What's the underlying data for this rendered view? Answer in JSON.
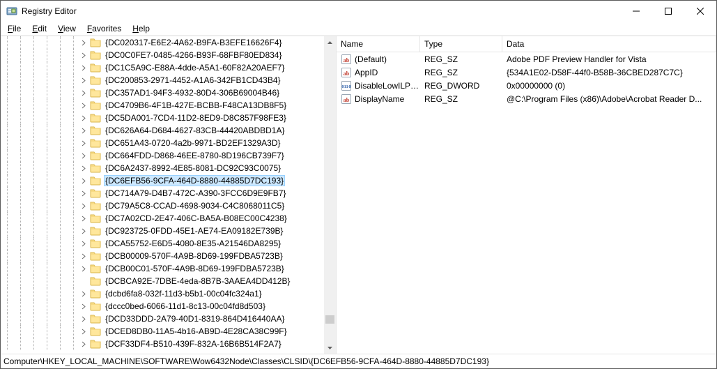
{
  "title": "Registry Editor",
  "menu": [
    "File",
    "Edit",
    "View",
    "Favorites",
    "Help"
  ],
  "tree": [
    {
      "label": "{DC020317-E6E2-4A62-B9FA-B3EFE16626F4}"
    },
    {
      "label": "{DC0C0FE7-0485-4266-B93F-68FBF80ED834}"
    },
    {
      "label": "{DC1C5A9C-E88A-4dde-A5A1-60F82A20AEF7}"
    },
    {
      "label": "{DC200853-2971-4452-A1A6-342FB1CD43B4}"
    },
    {
      "label": "{DC357AD1-94F3-4932-80D4-306B69004B46}"
    },
    {
      "label": "{DC4709B6-4F1B-427E-BCBB-F48CA13DB8F5}"
    },
    {
      "label": "{DC5DA001-7CD4-11D2-8ED9-D8C857F98FE3}"
    },
    {
      "label": "{DC626A64-D684-4627-83CB-44420ABDBD1A}"
    },
    {
      "label": "{DC651A43-0720-4a2b-9971-BD2EF1329A3D}"
    },
    {
      "label": "{DC664FDD-D868-46EE-8780-8D196CB739F7}"
    },
    {
      "label": "{DC6A2437-8992-4E85-8081-DC92C93C0075}"
    },
    {
      "label": "{DC6EFB56-9CFA-464D-8880-44885D7DC193}",
      "selected": true
    },
    {
      "label": "{DC714A79-D4B7-472C-A390-3FCC6D9E9FB7}"
    },
    {
      "label": "{DC79A5C8-CCAD-4698-9034-C4C8068011C5}"
    },
    {
      "label": "{DC7A02CD-2E47-406C-BA5A-B08EC00C4238}"
    },
    {
      "label": "{DC923725-0FDD-45E1-AE74-EA09182E739B}"
    },
    {
      "label": "{DCA55752-E6D5-4080-8E35-A21546DA8295}"
    },
    {
      "label": "{DCB00009-570F-4A9B-8D69-199FDBA5723B}"
    },
    {
      "label": "{DCB00C01-570F-4A9B-8D69-199FDBA5723B}"
    },
    {
      "label": "{DCBCA92E-7DBE-4eda-8B7B-3AAEA4DD412B}",
      "leaf": true
    },
    {
      "label": "{dcbd6fa8-032f-11d3-b5b1-00c04fc324a1}"
    },
    {
      "label": "{dccc0bed-6066-11d1-8c13-00c04fd8d503}"
    },
    {
      "label": "{DCD33DDD-2A79-40D1-8319-864D416440AA}"
    },
    {
      "label": "{DCED8DB0-11A5-4b16-AB9D-4E28CA38C99F}"
    },
    {
      "label": "{DCF33DF4-B510-439F-832A-16B6B514F2A7}"
    }
  ],
  "list": {
    "headers": {
      "name": "Name",
      "type": "Type",
      "data": "Data"
    },
    "rows": [
      {
        "icon": "sz",
        "name": "(Default)",
        "type": "REG_SZ",
        "data": "Adobe PDF Preview Handler for Vista"
      },
      {
        "icon": "sz",
        "name": "AppID",
        "type": "REG_SZ",
        "data": "{534A1E02-D58F-44f0-B58B-36CBED287C7C}"
      },
      {
        "icon": "dw",
        "name": "DisableLowILPro...",
        "type": "REG_DWORD",
        "data": "0x00000000 (0)"
      },
      {
        "icon": "sz",
        "name": "DisplayName",
        "type": "REG_SZ",
        "data": "@C:\\Program Files (x86)\\Adobe\\Acrobat Reader D..."
      }
    ]
  },
  "status": "Computer\\HKEY_LOCAL_MACHINE\\SOFTWARE\\Wow6432Node\\Classes\\CLSID\\{DC6EFB56-9CFA-464D-8880-44885D7DC193}"
}
